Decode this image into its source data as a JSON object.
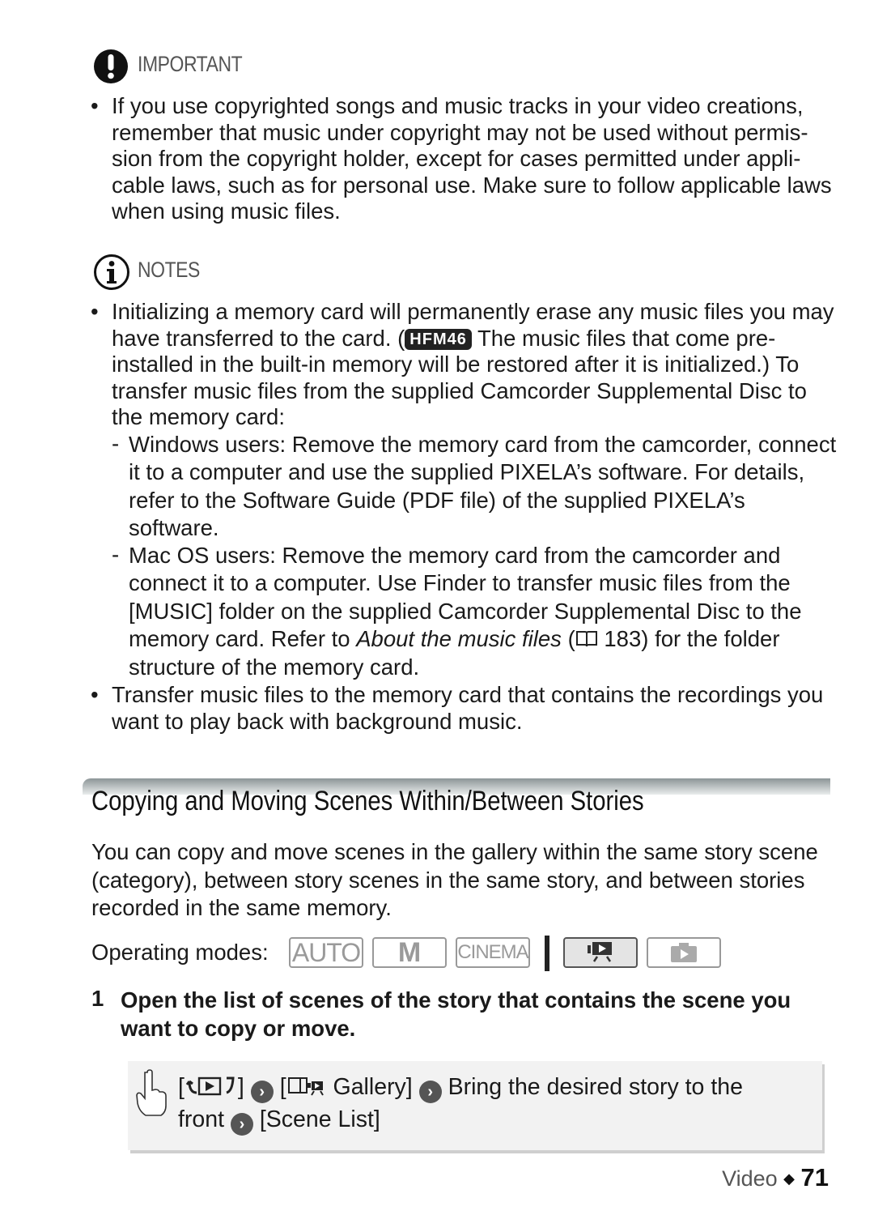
{
  "important": {
    "icon": "exclamation-circle-icon",
    "heading": "IMPORTANT",
    "bullets": [
      "If you use copyrighted songs and music tracks in your video creations, remember that music under copyright may not be used without permis-sion from the copyright holder, except for cases permitted under appli-cable laws, such as for personal use. Make sure to follow applicable laws when using music files."
    ]
  },
  "notes": {
    "icon": "info-circle-icon",
    "heading": "NOTES",
    "bullet1_pre": "Initializing a memory card will permanently erase any music files you may have transferred to the card. (",
    "bullet1_badge": "HFM46",
    "bullet1_post": " The music files that come pre-installed in the built-in memory will be restored after it is initialized.) To transfer music files from the supplied Camcorder Supplemental Disc to the memory card:",
    "sub1": "Windows users: Remove the memory card from the camcorder, connect it to a computer and use the supplied PIXELA’s software. For details, refer to the Software Guide (PDF file) of the supplied PIXELA’s software.",
    "sub2_pre": "Mac OS users: Remove the memory card from the camcorder and connect it to a computer. Use Finder to transfer music files from the [MUSIC] folder on the supplied Camcorder Supplemental Disc to the memory card. Refer to ",
    "sub2_link": "About the music files",
    "sub2_ref": " 183",
    "sub2_post": ") for the folder structure of the memory card.",
    "bullet2": "Transfer music files to the memory card that contains the recordings you want to play back with background music."
  },
  "section": {
    "title": "Copying and Moving Scenes Within/Between Stories",
    "intro": "You can copy and move scenes in the gallery within the same story scene (category), between story scenes in the same story, and between stories recorded in the same memory.",
    "modes_label": "Operating modes:",
    "modes": [
      "AUTO",
      "M",
      "CINEMA"
    ],
    "step_number": "1",
    "step_text": "Open the list of scenes of the story that contains the scene you want to copy or move.",
    "instr": {
      "gallery": "Gallery]",
      "bring": "Bring the desired story to the",
      "front": "front",
      "scene_list": "[Scene List]"
    }
  },
  "footer": {
    "section": "Video",
    "separator": "◆",
    "page": "71"
  }
}
